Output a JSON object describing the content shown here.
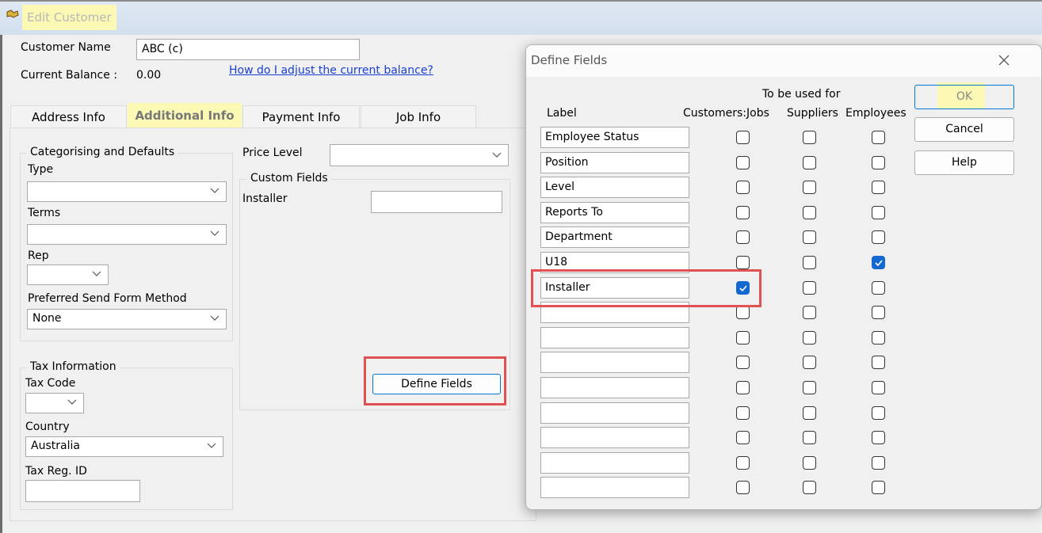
{
  "window": {
    "title": "Edit Customer"
  },
  "customer": {
    "name_label": "Customer Name",
    "name_value": "ABC (c)",
    "balance_label": "Current Balance :",
    "balance_value": "0.00",
    "balance_help_link": "How do I adjust the current balance?"
  },
  "tabs": [
    {
      "label": "Address Info",
      "active": false
    },
    {
      "label": "Additional Info",
      "active": true
    },
    {
      "label": "Payment Info",
      "active": false
    },
    {
      "label": "Job Info",
      "active": false
    }
  ],
  "categorising": {
    "legend": "Categorising and Defaults",
    "type_label": "Type",
    "type_value": "",
    "terms_label": "Terms",
    "terms_value": "",
    "rep_label": "Rep",
    "rep_value": "",
    "send_method_label": "Preferred Send Form Method",
    "send_method_value": "None"
  },
  "tax": {
    "legend": "Tax Information",
    "tax_code_label": "Tax Code",
    "tax_code_value": "",
    "country_label": "Country",
    "country_value": "Australia",
    "reg_id_label": "Tax Reg. ID",
    "reg_id_value": ""
  },
  "price_level": {
    "label": "Price Level",
    "value": ""
  },
  "custom_fields": {
    "legend": "Custom Fields",
    "installer_label": "Installer",
    "installer_value": "",
    "define_button": "Define Fields"
  },
  "define_dialog": {
    "title": "Define Fields",
    "group_header": "To be used for",
    "col_label": "Label",
    "col_customers": "Customers:Jobs",
    "col_suppliers": "Suppliers",
    "col_employees": "Employees",
    "ok_button": "OK",
    "cancel_button": "Cancel",
    "help_button": "Help",
    "rows": [
      {
        "label": "Employee Status",
        "customers": false,
        "suppliers": false,
        "employees": false
      },
      {
        "label": "Position",
        "customers": false,
        "suppliers": false,
        "employees": false
      },
      {
        "label": "Level",
        "customers": false,
        "suppliers": false,
        "employees": false
      },
      {
        "label": "Reports To",
        "customers": false,
        "suppliers": false,
        "employees": false
      },
      {
        "label": "Department",
        "customers": false,
        "suppliers": false,
        "employees": false
      },
      {
        "label": "U18",
        "customers": false,
        "suppliers": false,
        "employees": true
      },
      {
        "label": "Installer",
        "customers": true,
        "suppliers": false,
        "employees": false
      },
      {
        "label": "",
        "customers": false,
        "suppliers": false,
        "employees": false
      },
      {
        "label": "",
        "customers": false,
        "suppliers": false,
        "employees": false
      },
      {
        "label": "",
        "customers": false,
        "suppliers": false,
        "employees": false
      },
      {
        "label": "",
        "customers": false,
        "suppliers": false,
        "employees": false
      },
      {
        "label": "",
        "customers": false,
        "suppliers": false,
        "employees": false
      },
      {
        "label": "",
        "customers": false,
        "suppliers": false,
        "employees": false
      },
      {
        "label": "",
        "customers": false,
        "suppliers": false,
        "employees": false
      },
      {
        "label": "",
        "customers": false,
        "suppliers": false,
        "employees": false
      }
    ]
  },
  "colors": {
    "highlight": "#fbf9b4",
    "annotation_red": "#e05252",
    "checkbox_blue": "#1468d2",
    "link_blue": "#1a3fd1"
  }
}
